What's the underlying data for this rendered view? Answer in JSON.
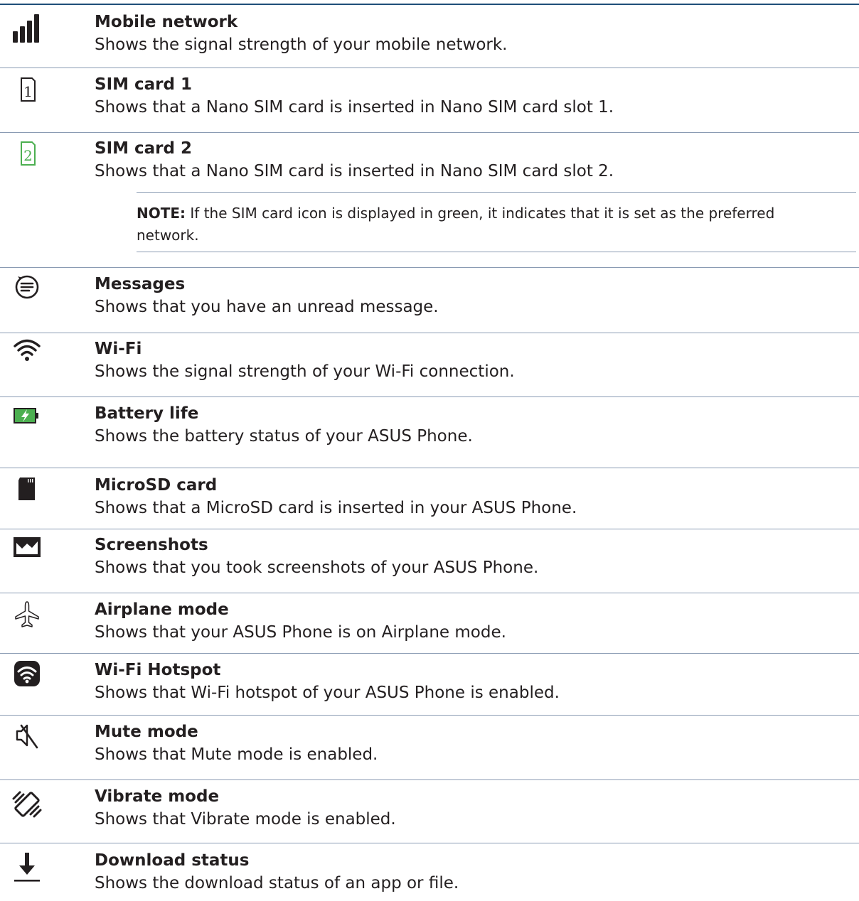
{
  "colors": {
    "rule": "#1f4e79",
    "divider": "#8a9bb3",
    "green": "#4caf50",
    "bolt": "#ffffff",
    "text": "#231f20"
  },
  "items": [
    {
      "icon": "signal-bars-icon",
      "title": "Mobile network",
      "desc": "Shows the signal strength of your mobile network."
    },
    {
      "icon": "sim-card-1-icon",
      "title": "SIM card 1",
      "desc": "Shows that a Nano SIM card is inserted in Nano SIM card slot 1.",
      "glyph": "1"
    },
    {
      "icon": "sim-card-2-icon",
      "title": "SIM card 2",
      "desc": "Shows that a Nano SIM card is inserted in Nano SIM card slot 2.",
      "glyph": "2"
    },
    {
      "icon": "messages-icon",
      "title": "Messages",
      "desc": "Shows that you have an unread message."
    },
    {
      "icon": "wifi-icon",
      "title": "Wi-Fi",
      "desc": "Shows the signal strength of your Wi-Fi connection."
    },
    {
      "icon": "battery-charging-icon",
      "title": "Battery life",
      "desc": "Shows the battery status of your ASUS Phone."
    },
    {
      "icon": "microsd-card-icon",
      "title": "MicroSD card",
      "desc": "Shows that a MicroSD card is inserted in your ASUS Phone."
    },
    {
      "icon": "screenshot-icon",
      "title": "Screenshots",
      "desc": "Shows that you took screenshots of your ASUS Phone."
    },
    {
      "icon": "airplane-icon",
      "title": "Airplane mode",
      "desc": "Shows that your ASUS Phone is on Airplane mode."
    },
    {
      "icon": "wifi-hotspot-icon",
      "title": "Wi-Fi Hotspot",
      "desc": "Shows that Wi-Fi hotspot of your ASUS Phone is enabled."
    },
    {
      "icon": "mute-icon",
      "title": "Mute mode",
      "desc": "Shows that Mute mode is enabled."
    },
    {
      "icon": "vibrate-icon",
      "title": "Vibrate mode",
      "desc": "Shows that Vibrate mode is enabled."
    },
    {
      "icon": "download-icon",
      "title": "Download status",
      "desc": "Shows the download status of an app or file."
    }
  ],
  "note": {
    "label": "NOTE:",
    "text": " If the SIM card icon is displayed in green, it indicates that it is set as the preferred network."
  }
}
